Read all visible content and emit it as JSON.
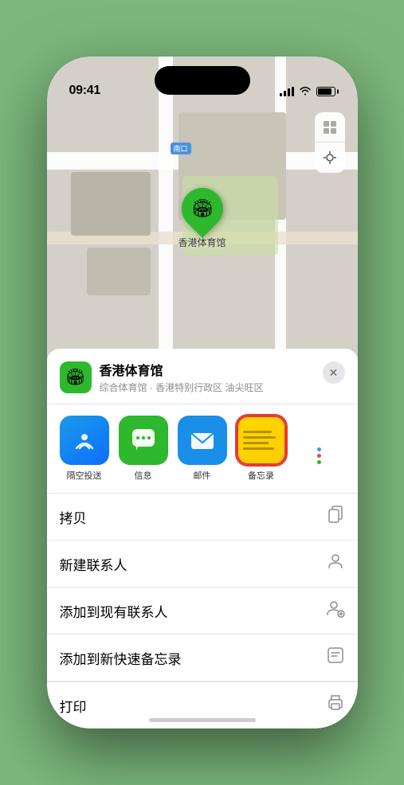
{
  "statusBar": {
    "time": "09:41",
    "locationArrow": "▶"
  },
  "map": {
    "labelTag": "南口",
    "stadiumName": "香港体育馆",
    "markerEmoji": "🏟"
  },
  "placeCard": {
    "name": "香港体育馆",
    "subtitle": "综合体育馆 · 香港特别行政区 油尖旺区",
    "closeLabel": "✕",
    "emoji": "🏟"
  },
  "apps": [
    {
      "id": "airdrop",
      "label": "隔空投送"
    },
    {
      "id": "messages",
      "label": "信息"
    },
    {
      "id": "mail",
      "label": "邮件"
    },
    {
      "id": "notes",
      "label": "备忘录"
    }
  ],
  "actions": [
    {
      "id": "copy",
      "label": "拷贝",
      "icon": "⎘"
    },
    {
      "id": "new-contact",
      "label": "新建联系人",
      "icon": "👤"
    },
    {
      "id": "add-to-contact",
      "label": "添加到现有联系人",
      "icon": "👤"
    },
    {
      "id": "quick-note",
      "label": "添加到新快速备忘录",
      "icon": "📝"
    }
  ],
  "partialRow": {
    "label": "打印",
    "icon": "🖨"
  },
  "mapControls": {
    "mapIcon": "🗺",
    "locationIcon": "⊕"
  }
}
